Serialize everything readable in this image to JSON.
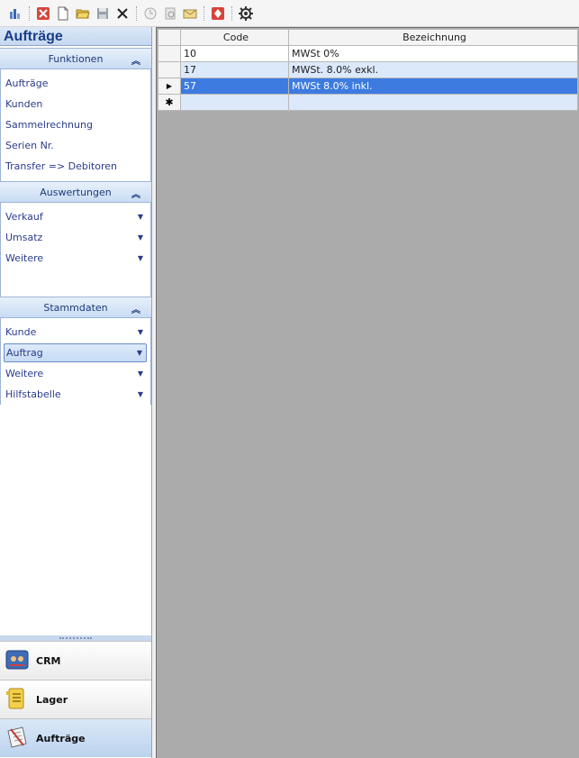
{
  "toolbar": {
    "buttons": [
      {
        "name": "chart-icon"
      },
      {
        "name": "close-window-icon"
      },
      {
        "name": "new-document-icon"
      },
      {
        "name": "open-folder-icon"
      },
      {
        "name": "save-icon"
      },
      {
        "name": "delete-icon"
      },
      {
        "name": "clock-icon"
      },
      {
        "name": "print-preview-icon"
      },
      {
        "name": "email-icon"
      },
      {
        "name": "pdf-icon"
      },
      {
        "name": "settings-icon"
      }
    ]
  },
  "module_title": "Aufträge",
  "groups": {
    "funktionen": {
      "title": "Funktionen",
      "items": [
        "Aufträge",
        "Kunden",
        "Sammelrechnung",
        "Serien Nr.",
        "Transfer => Debitoren"
      ]
    },
    "auswertungen": {
      "title": "Auswertungen",
      "items": [
        "Verkauf",
        "Umsatz",
        "Weitere"
      ]
    },
    "stammdaten": {
      "title": "Stammdaten",
      "items": [
        "Kunde",
        "Auftrag",
        "Weitere",
        "Hilfstabelle"
      ],
      "selected": "Auftrag"
    }
  },
  "nav": {
    "crm": "CRM",
    "lager": "Lager",
    "auftraege": "Aufträge"
  },
  "grid": {
    "columns": [
      "Code",
      "Bezeichnung"
    ],
    "rows": [
      {
        "code": "10",
        "bezeichnung": "MWSt 0%"
      },
      {
        "code": "17",
        "bezeichnung": "MWSt. 8.0% exkl."
      },
      {
        "code": "57",
        "bezeichnung": "MWSt 8.0% inkl."
      }
    ],
    "new_row_marker": "✱",
    "current_row_marker": "▶"
  },
  "colors": {
    "selection": "#3d7be0",
    "alt_row": "#dce9fb",
    "header_blue": "#1b3d8a"
  }
}
